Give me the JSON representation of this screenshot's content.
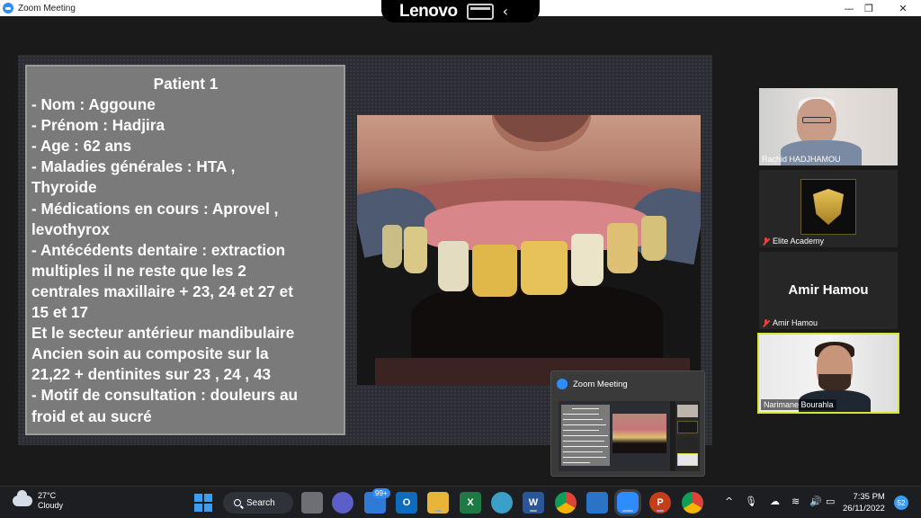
{
  "window": {
    "title": "Zoom Meeting",
    "controls": {
      "minimize": "—",
      "restore": "❐",
      "close": "✕"
    }
  },
  "lenovo_bar": {
    "brand": "Lenovo",
    "chevron": "‹"
  },
  "slide": {
    "title": "Patient 1",
    "lines": [
      "- Nom : Aggoune",
      "- Prénom : Hadjira",
      "- Age : 62 ans",
      "- Maladies générales : HTA ,",
      "Thyroide",
      "- Médications en cours : Aprovel ,",
      "levothyrox",
      "- Antécédents dentaire : extraction",
      "multiples il ne reste que les 2",
      "centrales maxillaire + 23, 24 et 27 et",
      "15 et 17",
      "Et le secteur antérieur mandibulaire",
      "Ancien soin au composite sur la",
      "21,22 + dentinites sur 23 , 24 , 43",
      "- Motif de consultation : douleurs au",
      "froid et au sucré"
    ]
  },
  "participants": [
    {
      "name": "Rachid HADJHAMOU",
      "muted": false
    },
    {
      "name": "Elite Academy",
      "muted": true
    },
    {
      "name": "Amir Hamou",
      "muted": true,
      "display_text": "Amir Hamou"
    },
    {
      "name": "Narimane Bourahla",
      "muted": false,
      "active_speaker": true
    }
  ],
  "preview": {
    "title": "Zoom Meeting"
  },
  "taskbar": {
    "weather": {
      "temp": "27°C",
      "condition": "Cloudy"
    },
    "search_label": "Search",
    "mail_badge": "99+",
    "clock": {
      "time": "7:35 PM",
      "date": "26/11/2022"
    },
    "notification_count": "52",
    "tray_chevron": "^"
  },
  "colors": {
    "zoom_blue": "#2d8cff",
    "active_speaker_border": "#dbe23a",
    "muted_red": "#e0443c",
    "slide_box": "#7a7a7a"
  },
  "icons": {
    "taskbar": [
      "windows-start-icon",
      "task-view-icon",
      "teams-chat-icon",
      "mail-icon",
      "outlook-icon",
      "file-explorer-icon",
      "excel-icon",
      "paint-icon",
      "word-icon",
      "chrome-icon",
      "snipping-tool-icon",
      "zoom-icon",
      "powerpoint-icon",
      "chrome-profile-icon"
    ]
  }
}
